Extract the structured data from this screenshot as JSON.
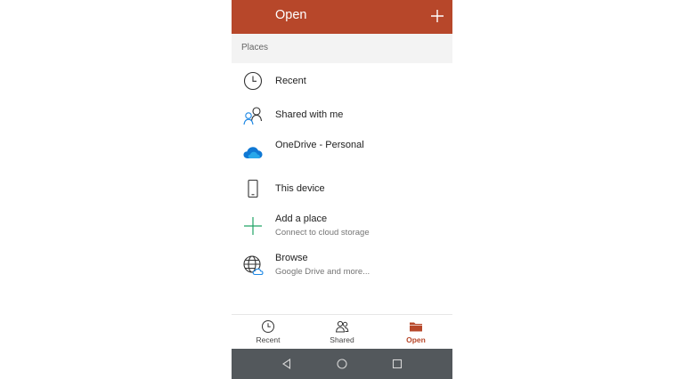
{
  "app": {
    "title": "Open",
    "accent_color": "#b7472a"
  },
  "places": {
    "header": "Places",
    "items": [
      {
        "title": "Recent",
        "icon": "clock-icon"
      },
      {
        "title": "Shared with me",
        "icon": "people-icon"
      },
      {
        "title": "OneDrive - Personal",
        "icon": "onedrive-cloud-icon"
      },
      {
        "title": "This device",
        "icon": "phone-device-icon"
      },
      {
        "title": "Add a place",
        "subtitle": "Connect to cloud storage",
        "icon": "plus-icon"
      },
      {
        "title": "Browse",
        "subtitle": "Google Drive and more...",
        "icon": "globe-icon"
      }
    ]
  },
  "bottom_nav": {
    "items": [
      {
        "label": "Recent",
        "icon": "clock-icon"
      },
      {
        "label": "Shared",
        "icon": "people-icon"
      },
      {
        "label": "Open",
        "icon": "folder-icon",
        "active": true
      }
    ]
  },
  "system_nav": {
    "icons": [
      "back-icon",
      "home-icon",
      "overview-icon"
    ]
  }
}
